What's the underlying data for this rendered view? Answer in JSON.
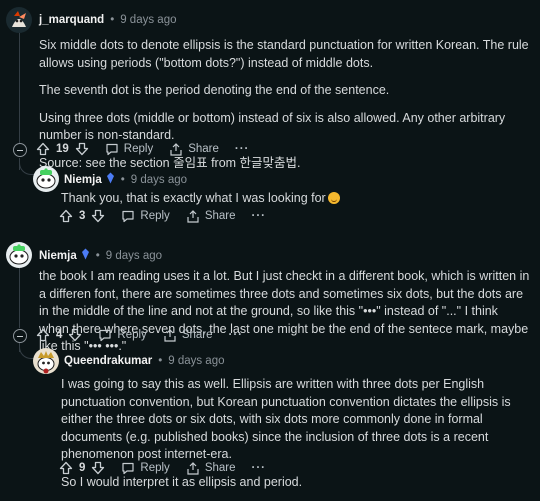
{
  "comments": [
    {
      "user": "j_marquand",
      "time": "9 days ago",
      "paragraphs": [
        "Six middle dots to denote ellipsis is the standard punctuation for written Korean. The rule allows using periods (\"bottom dots?\") instead of middle dots.",
        "The seventh dot is the period denoting the end of the sentence.",
        "Using three dots (middle or bottom) instead of six is also allowed. Any other arbitrary number is non-standard.",
        "Source: see the section 줄임표 from 한글맞춤법."
      ],
      "votes": "19",
      "reply": "Reply",
      "share": "Share",
      "more": "···"
    },
    {
      "user": "Niemja",
      "time": "9 days ago",
      "text": "Thank you, that is exactly what I was looking for",
      "votes": "3",
      "reply": "Reply",
      "share": "Share",
      "more": "···"
    },
    {
      "user": "Niemja",
      "time": "9 days ago",
      "text": "the book I am reading uses it a lot. But I just checkt in a different book, which is written in a differen font, there are sometimes three dots and sometimes six dots, but the dots are in the middle of the line and not at the ground, so like this \"•••\" instead of \"...\" I think when there where seven dots, the last one might be the end of the sentece mark, maybe like this \"••• •••.\"",
      "votes": "4",
      "reply": "Reply",
      "share": "Share",
      "more": "···"
    },
    {
      "user": "Queendrakumar",
      "time": "9 days ago",
      "paragraphs": [
        "I was going to say this as well. Ellipsis are written with three dots per English punctuation convention, but Korean punctuation convention dictates the ellipsis is either the three dots or six dots, with six dots more commonly done in formal documents (e.g. published books) since the inclusion of three dots is a recent phenomenon post internet-era.",
        "So I would interpret it as ellipsis and period."
      ],
      "votes": "9",
      "reply": "Reply",
      "share": "Share",
      "more": "···"
    }
  ],
  "colors": {
    "bg": "#0b1416",
    "text": "#d7dadc",
    "muted": "#8a9298",
    "badge": "#4c7cf5"
  },
  "icons": [
    "upvote-icon",
    "downvote-icon",
    "comment-icon",
    "share-icon",
    "collapse-icon",
    "verified-badge-icon",
    "grinning-emoji"
  ]
}
